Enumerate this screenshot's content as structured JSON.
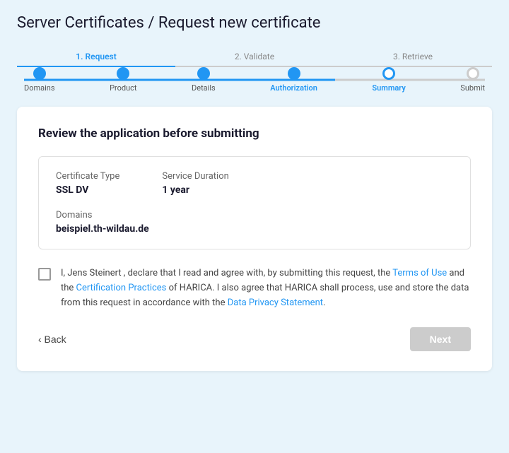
{
  "page": {
    "title": "Server Certificates / Request new certificate"
  },
  "top_steps": [
    {
      "id": "request",
      "label": "1. Request",
      "active": true
    },
    {
      "id": "validate",
      "label": "2. Validate",
      "active": false
    },
    {
      "id": "retrieve",
      "label": "3. Retrieve",
      "active": false
    }
  ],
  "progress_steps": [
    {
      "id": "domains",
      "label": "Domains",
      "state": "filled"
    },
    {
      "id": "product",
      "label": "Product",
      "state": "filled"
    },
    {
      "id": "details",
      "label": "Details",
      "state": "filled"
    },
    {
      "id": "authorization",
      "label": "Authorization",
      "state": "filled"
    },
    {
      "id": "summary",
      "label": "Summary",
      "state": "empty"
    },
    {
      "id": "submit",
      "label": "Submit",
      "state": "inactive"
    }
  ],
  "main": {
    "review_title": "Review the application before submitting",
    "info": {
      "certificate_type_label": "Certificate Type",
      "certificate_type_value": "SSL DV",
      "service_duration_label": "Service Duration",
      "service_duration_value": "1 year",
      "domains_label": "Domains",
      "domains_value": "beispiel.th-wildau.de"
    },
    "agreement": {
      "text_before": "I, Jens Steinert , declare that I read and agree with, by submitting this request, the ",
      "terms_link": "Terms of Use",
      "text_middle": " and the ",
      "cert_link": "Certification Practices",
      "text_after": " of HARICA. I also agree that HARICA shall process, use and store the data from this request in accordance with the ",
      "privacy_link": "Data Privacy Statement",
      "text_end": "."
    },
    "back_label": "‹ Back",
    "next_label": "Next"
  }
}
